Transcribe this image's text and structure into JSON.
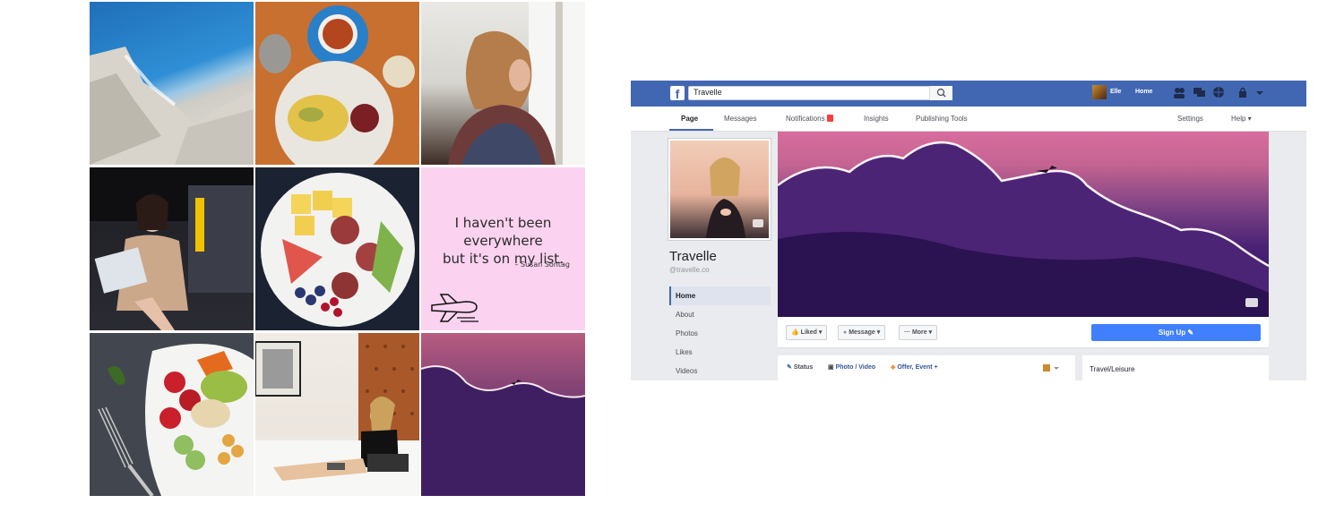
{
  "grid": {
    "quote_lines": [
      "I haven't been everywhere",
      "but it's on my list."
    ],
    "quote_author": "– Susan Sontag"
  },
  "facebook": {
    "search_value": "Travelle",
    "user_name": "Elle",
    "home_label": "Home",
    "page_nav": {
      "page": "Page",
      "messages": "Messages",
      "notifications": "Notifications",
      "insights": "Insights",
      "publishing_tools": "Publishing Tools",
      "settings": "Settings",
      "help": "Help ▾"
    },
    "page_name": "Travelle",
    "page_handle": "@travelle.co",
    "sidebar_items": [
      "Home",
      "About",
      "Photos",
      "Likes",
      "Videos"
    ],
    "actions": {
      "liked": "Liked ▾",
      "message": "Message ▾",
      "more": "··· More ▾",
      "signup": "Sign Up ✎"
    },
    "composer": {
      "status": "Status",
      "photo_video": "Photo / Video",
      "offer_event": "Offer, Event +"
    },
    "about_category": "Travel/Leisure",
    "colors": {
      "brand": "#4267b2",
      "signup": "#4080ff",
      "link": "#365899"
    },
    "icons": [
      "facebook-logo-icon",
      "search-icon",
      "friends-icon",
      "messages-icon",
      "globe-icon",
      "lock-icon",
      "camera-icon",
      "thumbs-up-icon",
      "pencil-icon"
    ]
  }
}
